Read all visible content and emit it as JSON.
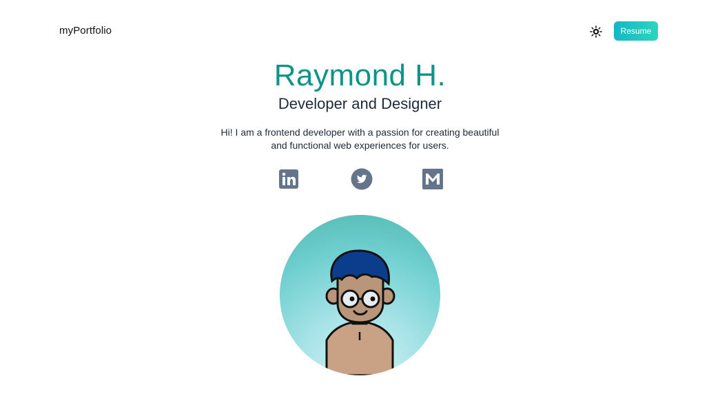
{
  "nav": {
    "logo": "myPortfolio",
    "theme_icon": "sun-icon",
    "resume_label": "Resume"
  },
  "hero": {
    "name": "Raymond H.",
    "role": "Developer and Designer",
    "bio": "Hi! I am a frontend developer with a passion for creating beautiful and functional web experiences for users."
  },
  "socials": [
    {
      "icon": "linkedin-icon"
    },
    {
      "icon": "twitter-icon"
    },
    {
      "icon": "gmail-icon"
    }
  ],
  "colors": {
    "accent": "#0d9488",
    "button": "#14b8c4",
    "icon": "#64748b"
  }
}
